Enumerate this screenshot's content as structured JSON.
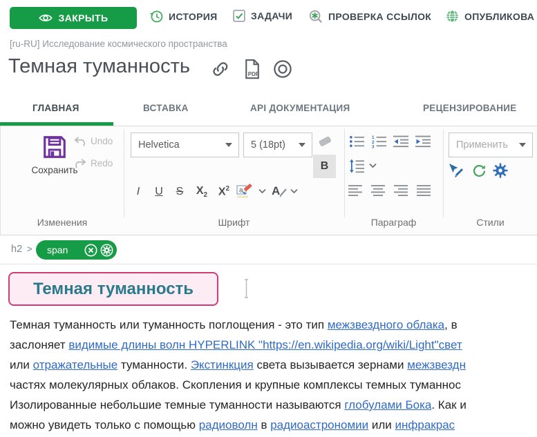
{
  "colors": {
    "brand_green": "#169c46",
    "heading_teal": "#2b7a8c",
    "highlight_pink_border": "#d23c76",
    "highlight_pink_bg": "#fdecf3",
    "link_blue": "#2f6bc6",
    "icon_blue": "#2e6fb7",
    "save_purple": "#7030a0"
  },
  "top_toolbar": {
    "close_label": "ЗАКРЫТЬ",
    "history_label": "ИСТОРИЯ",
    "tasks_label": "ЗАДАЧИ",
    "link_check_label": "ПРОВЕРКА ССЫЛОК",
    "publish_label": "ОПУБЛИКОВА"
  },
  "breadcrumb": "[ru-RU] Исследование космического пространства",
  "document": {
    "title": "Темная туманность"
  },
  "tabs": [
    {
      "label": "ГЛАВНАЯ",
      "active": true
    },
    {
      "label": "ВСТАВКА",
      "active": false
    },
    {
      "label": "API ДОКУМЕНТАЦИЯ",
      "active": false
    },
    {
      "label": "РЕЦЕНЗИРОВАНИЕ",
      "active": false
    }
  ],
  "ribbon": {
    "save_label": "Сохранить",
    "undo_label": "Undo",
    "redo_label": "Redo",
    "font_family": "Helvetica",
    "font_size": "5 (18pt)",
    "bold_label": "B",
    "italic_label": "I",
    "underline_label": "U",
    "strikethrough_label": "S",
    "subscript": {
      "base": "X",
      "script": "2"
    },
    "superscript": {
      "base": "X",
      "script": "2"
    },
    "apply_placeholder": "Применить",
    "group_changes": "Изменения",
    "group_font": "Шрифт",
    "group_paragraph": "Параграф",
    "group_styles": "Стили"
  },
  "element_path": {
    "ancestor": "h2",
    "separator": ">",
    "selected": "span"
  },
  "editor": {
    "heading": "Темная туманность",
    "paragraph_lines": [
      [
        {
          "t": "Темная туманность или туманность поглощения - это тип ",
          "link": false
        },
        {
          "t": "межзвездного облака",
          "link": true
        },
        {
          "t": ", в",
          "link": false
        }
      ],
      [
        {
          "t": "заслоняет ",
          "link": false
        },
        {
          "t": "видимые длины волн HYPERLINK \"https://en.wikipedia.org/wiki/Light\"свет",
          "link": true
        }
      ],
      [
        {
          "t": "или ",
          "link": false
        },
        {
          "t": "отражательные",
          "link": true
        },
        {
          "t": " туманности. ",
          "link": false
        },
        {
          "t": "Экстинкция",
          "link": true
        },
        {
          "t": " света вызывается зернами ",
          "link": false
        },
        {
          "t": "межзвездн",
          "link": true
        }
      ],
      [
        {
          "t": "частях молекулярных облаков. Скопления и крупные комплексы темных туманнос",
          "link": false
        }
      ],
      [
        {
          "t": "Изолированные небольшие темные туманности называются ",
          "link": false
        },
        {
          "t": "глобулами Бока",
          "link": true
        },
        {
          "t": ". Как и",
          "link": false
        }
      ],
      [
        {
          "t": "можно увидеть только с помощью ",
          "link": false
        },
        {
          "t": "радиоволн",
          "link": true
        },
        {
          "t": " в ",
          "link": false
        },
        {
          "t": "радиоастрономии",
          "link": true
        },
        {
          "t": " или ",
          "link": false
        },
        {
          "t": "инфракрас",
          "link": true
        }
      ]
    ]
  }
}
